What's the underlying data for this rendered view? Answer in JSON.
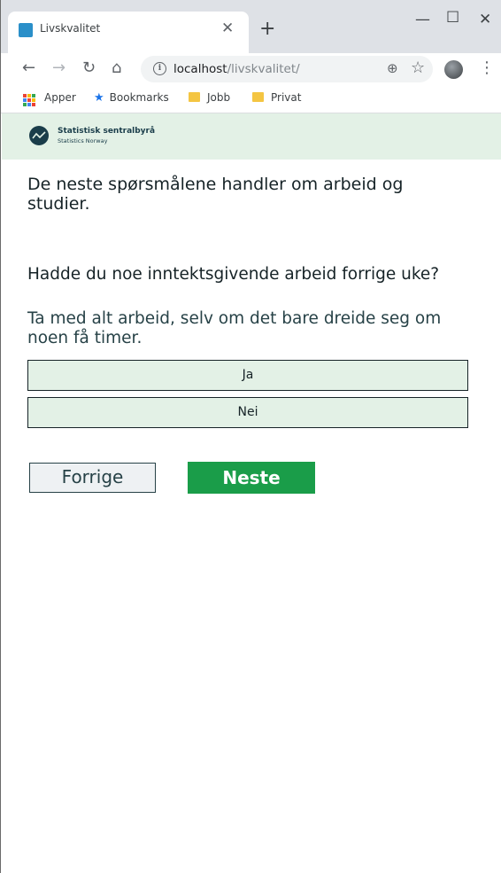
{
  "browser": {
    "tab_title": "Livskvalitet",
    "url_host": "localhost",
    "url_path": "/livskvalitet/",
    "bookmarks": [
      {
        "label": "Apper"
      },
      {
        "label": "Bookmarks"
      },
      {
        "label": "Jobb"
      },
      {
        "label": "Privat"
      }
    ]
  },
  "header": {
    "org_name": "Statistisk sentralbyrå",
    "org_subtitle": "Statistics Norway"
  },
  "survey": {
    "intro": "De neste spørsmålene handler om arbeid og studier.",
    "question": "Hadde du noe inntektsgivende arbeid forrige uke?",
    "help_text": "Ta med alt arbeid, selv om det bare dreide seg om noen få timer.",
    "options": [
      {
        "label": "Ja"
      },
      {
        "label": "Nei"
      }
    ],
    "prev_label": "Forrige",
    "next_label": "Neste"
  },
  "colors": {
    "header_bg": "#e3f1e6",
    "option_bg": "#e3f1e6",
    "next_bg": "#1a9d49",
    "text_dark": "#162327"
  }
}
